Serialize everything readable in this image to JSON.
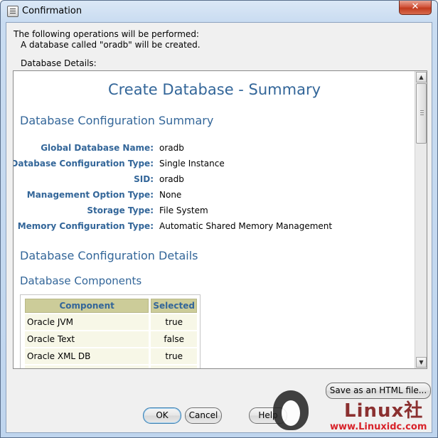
{
  "window": {
    "title": "Confirmation",
    "close_glyph": "✕",
    "icon": "app-icon"
  },
  "intro": {
    "line1": "The following operations will be performed:",
    "line2": "A database called \"oradb\" will be created.",
    "details_label": "Database Details:"
  },
  "summary": {
    "title": "Create Database - Summary",
    "section1": "Database Configuration Summary",
    "rows": [
      {
        "key": "Global Database Name:",
        "value": "oradb"
      },
      {
        "key": "Database Configuration Type:",
        "value": "Single Instance"
      },
      {
        "key": "SID:",
        "value": "oradb"
      },
      {
        "key": "Management Option Type:",
        "value": "None"
      },
      {
        "key": "Storage Type:",
        "value": "File System"
      },
      {
        "key": "Memory Configuration Type:",
        "value": "Automatic Shared Memory Management"
      }
    ],
    "section2": "Database Configuration Details",
    "section3": "Database Components",
    "components": {
      "headers": {
        "component": "Component",
        "selected": "Selected"
      },
      "rows": [
        {
          "component": "Oracle JVM",
          "selected": "true"
        },
        {
          "component": "Oracle Text",
          "selected": "false"
        },
        {
          "component": "Oracle XML DB",
          "selected": "true"
        },
        {
          "component": "",
          "selected": ""
        }
      ]
    }
  },
  "buttons": {
    "save_html": "Save as an HTML file...",
    "ok": "OK",
    "cancel": "Cancel",
    "help": "Help"
  },
  "watermark": {
    "text": "Linux社",
    "url": "www.Linuxidc.com"
  },
  "colors": {
    "heading": "#336699",
    "table_header_bg": "#cccc99",
    "table_cell_bg": "#f7f7e7"
  }
}
